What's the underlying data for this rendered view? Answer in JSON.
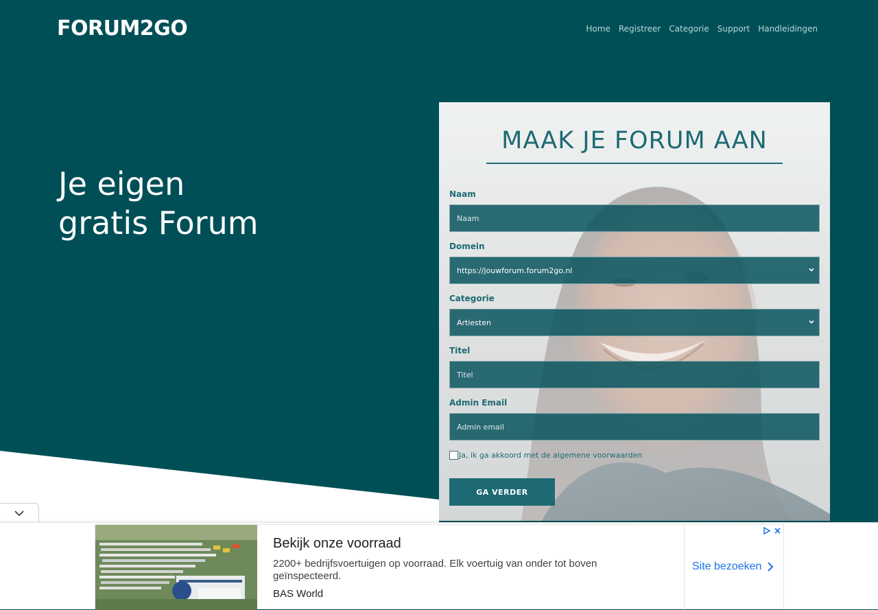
{
  "header": {
    "logo_text": "FORUM2GO",
    "nav": [
      "Home",
      "Registreer",
      "Categorie",
      "Support",
      "Handleidingen"
    ]
  },
  "hero": {
    "title_line1": "Je eigen",
    "title_line2": "gratis Forum"
  },
  "form": {
    "title": "MAAK JE FORUM AAN",
    "fields": [
      {
        "label": "Naam",
        "placeholder": "Naam",
        "type": "text"
      },
      {
        "label": "Domein",
        "value": "https://jouwforum.forum2go.nl",
        "type": "select"
      },
      {
        "label": "Categorie",
        "value": "Artiesten",
        "type": "select"
      },
      {
        "label": "Titel",
        "placeholder": "Titel",
        "type": "text"
      },
      {
        "label": "Admin Email",
        "placeholder": "Admin email",
        "type": "text"
      }
    ],
    "agree_label": "Ja, ik ga akkoord met de algemene voorwaarden",
    "submit_label": "GA VERDER"
  },
  "ad": {
    "headline": "Bekijk onze voorraad",
    "description": "2200+ bedrijfsvoertuigen op voorraad. Elk voertuig van onder tot boven geïnspecteerd.",
    "advertiser": "BAS World",
    "cta": "Site bezoeken"
  },
  "colors": {
    "background": "#004f57",
    "accent": "#1d6a74",
    "field_fill": "#0a555f",
    "ad_link": "#1a73e8"
  },
  "icons": {
    "collapse": "chevron-down-icon",
    "select_arrow": "chevron-down-icon",
    "ad_cta_arrow": "chevron-right-icon",
    "ad_choices": "adchoices-icon",
    "ad_close": "close-icon"
  }
}
